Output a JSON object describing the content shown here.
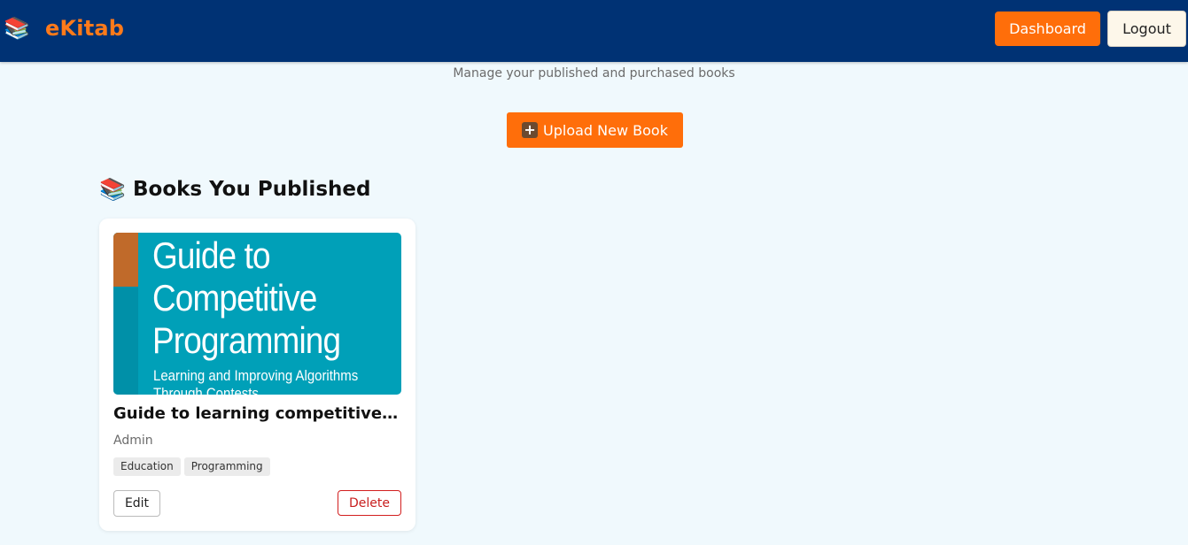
{
  "header": {
    "brand_icon": "books-icon",
    "brand_name": "eKitab",
    "dashboard_label": "Dashboard",
    "logout_label": "Logout"
  },
  "page": {
    "subtitle": "Manage your published and purchased books",
    "upload_label": "Upload New Book",
    "upload_icon": "plus-icon"
  },
  "published": {
    "section_title": "Books You Published",
    "section_icon": "books-icon",
    "books": [
      {
        "cover_title_lines": [
          "Guide to",
          "Competitive",
          "Programming"
        ],
        "cover_subtitle": "Learning and Improving Algorithms Through Contests",
        "title": "Guide to learning competitive programming",
        "author": "Admin",
        "tags": [
          "Education",
          "Programming"
        ],
        "edit_label": "Edit",
        "delete_label": "Delete"
      }
    ]
  },
  "colors": {
    "navbar": "#003274",
    "accent": "#ff6e0a",
    "background": "#f0f9fd",
    "cover": "#00a0b8",
    "danger": "#c81e1e"
  }
}
